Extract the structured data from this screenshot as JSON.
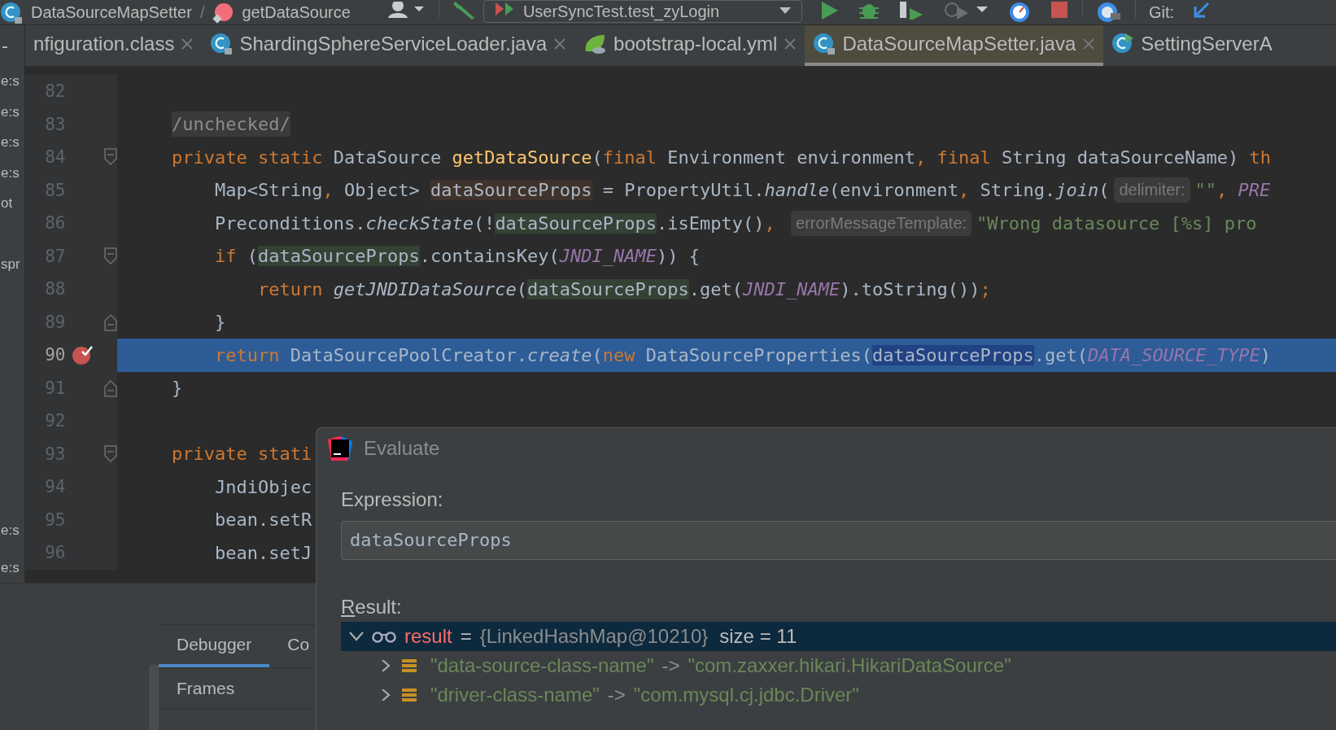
{
  "breadcrumb": [
    {
      "label": "DataSourceMapSetter",
      "kind": "class"
    },
    {
      "label": "getDataSource",
      "kind": "method"
    }
  ],
  "breadcrumb_separator": "/",
  "run_configuration": {
    "label": "UserSyncTest.test_zyLogin"
  },
  "git_label": "Git:",
  "project_panel": {
    "toggle": "-",
    "upper": [
      "e:s",
      "e:s",
      "e:s",
      "e:s",
      "ot"
    ],
    "middle": [
      "spr"
    ],
    "lower": [
      "e:s",
      "e:s"
    ]
  },
  "tabs": [
    {
      "label": "nfiguration.class",
      "kind": "file",
      "closable": true,
      "selected": false
    },
    {
      "label": "ShardingSphereServiceLoader.java",
      "kind": "class",
      "closable": true,
      "selected": false
    },
    {
      "label": "bootstrap-local.yml",
      "kind": "spring",
      "closable": true,
      "selected": false
    },
    {
      "label": "DataSourceMapSetter.java",
      "kind": "class",
      "closable": true,
      "selected": true
    },
    {
      "label": "SettingServerA",
      "kind": "runnable",
      "closable": false,
      "selected": false
    }
  ],
  "code_lines": [
    {
      "number": "82",
      "fold_start": false,
      "fold_end": false,
      "breakpoint": false,
      "current": false
    },
    {
      "number": "83",
      "fold_start": false,
      "fold_end": false,
      "breakpoint": false,
      "current": false,
      "tokens": [
        {
          "text": "/unchecked/",
          "kind": "folded"
        }
      ]
    },
    {
      "number": "84",
      "fold_start": true,
      "fold_end": false,
      "breakpoint": false,
      "current": false,
      "tokens": [
        {
          "text": "private static ",
          "kind": "kw"
        },
        {
          "text": "DataSource ",
          "kind": "plain"
        },
        {
          "text": "getDataSource",
          "kind": "decl"
        },
        {
          "text": "(",
          "kind": "plain"
        },
        {
          "text": "final ",
          "kind": "kw"
        },
        {
          "text": "Environment environment",
          "kind": "plain"
        },
        {
          "text": ", final ",
          "kind": "kw"
        },
        {
          "text": "String dataSourceName) ",
          "kind": "plain"
        },
        {
          "text": "th",
          "kind": "kw"
        }
      ]
    },
    {
      "number": "85",
      "fold_start": false,
      "fold_end": false,
      "breakpoint": false,
      "current": false,
      "tokens": [
        {
          "text": "    Map<String",
          "kind": "plain"
        },
        {
          "text": ", ",
          "kind": "kw"
        },
        {
          "text": "Object> ",
          "kind": "plain"
        },
        {
          "text": "dataSourceProps",
          "kind": "write"
        },
        {
          "text": " = PropertyUtil.",
          "kind": "plain"
        },
        {
          "text": "handle",
          "kind": "italic"
        },
        {
          "text": "(environment",
          "kind": "plain"
        },
        {
          "text": ", ",
          "kind": "kw"
        },
        {
          "text": "String.",
          "kind": "plain"
        },
        {
          "text": "join",
          "kind": "italic"
        },
        {
          "text": "(",
          "kind": "plain"
        },
        {
          "text": "delimiter:",
          "kind": "hint"
        },
        {
          "text": "\"\"",
          "kind": "str"
        },
        {
          "text": ", ",
          "kind": "kw"
        },
        {
          "text": "PRE",
          "kind": "const"
        }
      ]
    },
    {
      "number": "86",
      "fold_start": false,
      "fold_end": false,
      "breakpoint": false,
      "current": false,
      "tokens": [
        {
          "text": "    Preconditions.",
          "kind": "plain"
        },
        {
          "text": "checkState",
          "kind": "italic"
        },
        {
          "text": "(!",
          "kind": "plain"
        },
        {
          "text": "dataSourceProps",
          "kind": "read"
        },
        {
          "text": ".isEmpty()",
          "kind": "plain"
        },
        {
          "text": ", ",
          "kind": "kw"
        },
        {
          "text": "errorMessageTemplate:",
          "kind": "hint"
        },
        {
          "text": "\"Wrong datasource [%s] pro",
          "kind": "str"
        }
      ]
    },
    {
      "number": "87",
      "fold_start": true,
      "fold_end": false,
      "breakpoint": false,
      "current": false,
      "tokens": [
        {
          "text": "    if ",
          "kind": "kw"
        },
        {
          "text": "(",
          "kind": "plain"
        },
        {
          "text": "dataSourceProps",
          "kind": "read"
        },
        {
          "text": ".containsKey(",
          "kind": "plain"
        },
        {
          "text": "JNDI_NAME",
          "kind": "const"
        },
        {
          "text": ")) {",
          "kind": "plain"
        }
      ]
    },
    {
      "number": "88",
      "fold_start": false,
      "fold_end": false,
      "breakpoint": false,
      "current": false,
      "tokens": [
        {
          "text": "        return ",
          "kind": "kw"
        },
        {
          "text": "getJNDIDataSource",
          "kind": "italic"
        },
        {
          "text": "(",
          "kind": "plain"
        },
        {
          "text": "dataSourceProps",
          "kind": "read"
        },
        {
          "text": ".get(",
          "kind": "plain"
        },
        {
          "text": "JNDI_NAME",
          "kind": "const"
        },
        {
          "text": ").toString())",
          "kind": "plain"
        },
        {
          "text": ";",
          "kind": "kw"
        }
      ]
    },
    {
      "number": "89",
      "fold_start": false,
      "fold_end": true,
      "breakpoint": false,
      "current": false,
      "tokens": [
        {
          "text": "    }",
          "kind": "plain"
        }
      ]
    },
    {
      "number": "90",
      "fold_start": false,
      "fold_end": false,
      "breakpoint": true,
      "current": true,
      "tokens": [
        {
          "text": "    return ",
          "kind": "kw"
        },
        {
          "text": "DataSourcePoolCreator.",
          "kind": "plain"
        },
        {
          "text": "create",
          "kind": "italic"
        },
        {
          "text": "(",
          "kind": "plain"
        },
        {
          "text": "new ",
          "kind": "kw"
        },
        {
          "text": "DataSourceProperties(",
          "kind": "plain"
        },
        {
          "text": "dataSourceProps",
          "kind": "sel"
        },
        {
          "text": ".get(",
          "kind": "plain"
        },
        {
          "text": "DATA_SOURCE_TYPE",
          "kind": "const"
        },
        {
          "text": ")",
          "kind": "plain"
        }
      ]
    },
    {
      "number": "91",
      "fold_start": false,
      "fold_end": true,
      "breakpoint": false,
      "current": false,
      "tokens": [
        {
          "text": "}",
          "kind": "plain"
        }
      ]
    },
    {
      "number": "92",
      "fold_start": false,
      "fold_end": false,
      "breakpoint": false,
      "current": false
    },
    {
      "number": "93",
      "fold_start": true,
      "fold_end": false,
      "breakpoint": false,
      "current": false,
      "tokens": [
        {
          "text": "private stati",
          "kind": "kw"
        }
      ]
    },
    {
      "number": "94",
      "fold_start": false,
      "fold_end": false,
      "breakpoint": false,
      "current": false,
      "tokens": [
        {
          "text": "    JndiObjec",
          "kind": "plain"
        }
      ]
    },
    {
      "number": "95",
      "fold_start": false,
      "fold_end": false,
      "breakpoint": false,
      "current": false,
      "tokens": [
        {
          "text": "    bean.setR",
          "kind": "plain"
        }
      ]
    },
    {
      "number": "96",
      "fold_start": false,
      "fold_end": false,
      "breakpoint": false,
      "current": false,
      "tokens": [
        {
          "text": "    bean.setJ",
          "kind": "plain"
        }
      ]
    }
  ],
  "debug_panel": {
    "tabs": [
      {
        "label": "Debugger",
        "selected": true
      },
      {
        "label": "Co",
        "selected": false
      }
    ],
    "frames_header": "Frames"
  },
  "evaluate_dialog": {
    "title": "Evaluate",
    "expression_label": "Expression:",
    "expression": "dataSourceProps",
    "result_label": "Result:",
    "rows": [
      {
        "kind": "root",
        "expanded": true,
        "selected": true,
        "name": "result",
        "operator": "=",
        "value": "{LinkedHashMap@10210}",
        "size": "size = 11"
      },
      {
        "kind": "entry",
        "expanded": false,
        "selected": false,
        "name": "\"data-source-class-name\"",
        "operator": "->",
        "value": "\"com.zaxxer.hikari.HikariDataSource\""
      },
      {
        "kind": "entry",
        "expanded": false,
        "selected": false,
        "name": "\"driver-class-name\"",
        "operator": "->",
        "value": "\"com.mysql.cj.jdbc.Driver\""
      }
    ]
  }
}
